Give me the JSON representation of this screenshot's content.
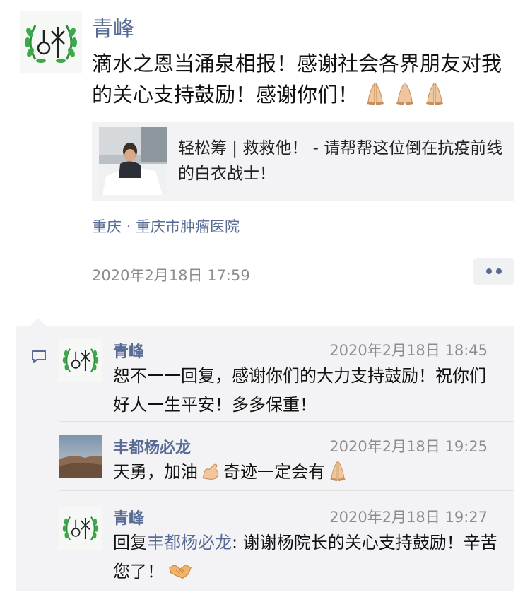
{
  "post": {
    "author": "青峰",
    "text": "滴水之恩当涌泉相报！感谢社会各界朋友对我的关心支持鼓励！感谢你们！",
    "emojis": [
      "folded-hands-icon",
      "folded-hands-icon",
      "folded-hands-icon"
    ],
    "share": {
      "title": "轻松筹 | 救救他！ - 请帮帮这位倒在抗疫前线的白衣战士！"
    },
    "location": "重庆 · 重庆市肿瘤医院",
    "time": "2020年2月18日 17:59"
  },
  "comments": [
    {
      "author": "青峰",
      "time": "2020年2月18日 18:45",
      "text": "恕不一一回复，感谢你们的大力支持鼓励！祝你们好人一生平安！多多保重！"
    },
    {
      "author": "丰都杨必龙",
      "time": "2020年2月18日 19:25",
      "text_a": "天勇，加油",
      "text_b": "奇迹一定会有"
    },
    {
      "author": "青峰",
      "time": "2020年2月18日 19:27",
      "reply_prefix": "回复",
      "reply_to": "丰都杨必龙",
      "text": ": 谢谢杨院长的关心支持鼓励！辛苦您了！"
    }
  ],
  "colors": {
    "link": "#576b95",
    "panel": "#f3f3f5",
    "meta": "#8c8c8c"
  }
}
